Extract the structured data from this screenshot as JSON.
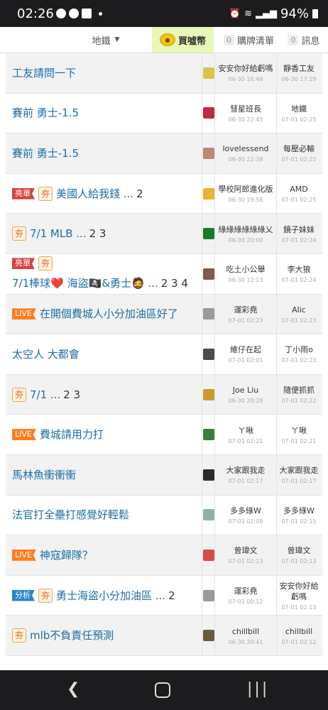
{
  "status": {
    "time": "02:26",
    "battery": "94%"
  },
  "tabs": {
    "board": "地鐵",
    "buy": "買噓幣",
    "list_count": "0",
    "list_label": "購牌清單",
    "msg_count": "0",
    "msg_label": "訊息"
  },
  "threads": [
    {
      "tags": [],
      "title": "工友請問一下",
      "pages": "",
      "author": "安安你好給虧嗎",
      "post_date": "06-30 16:46",
      "last_author": "靜香工友",
      "last_date": "06-30 17:29",
      "thumb_color": "#d9c54a"
    },
    {
      "tags": [],
      "title": "賽前 勇士-1.5",
      "pages": "",
      "author": "彗星班長",
      "post_date": "06-30 22:45",
      "last_author": "地鐵",
      "last_date": "07-01 02:25",
      "thumb_color": "#c3264a"
    },
    {
      "tags": [],
      "title": "賽前 勇士-1.5",
      "pages": "",
      "author": "lovelessend",
      "post_date": "06-30 22:38",
      "last_author": "每壓必輸",
      "last_date": "07-01 02:25",
      "thumb_color": "#b98a78"
    },
    {
      "tags": [
        "亮單",
        "夯"
      ],
      "title": "美國人給我錢 ...",
      "pages": "2",
      "author": "學校阿郎進化版",
      "post_date": "06-30 19:58",
      "last_author": "AMD",
      "last_date": "07-01 02:25",
      "thumb_color": "#e5b533"
    },
    {
      "tags": [
        "夯"
      ],
      "title": "7/1 MLB ...",
      "pages": "2 3",
      "author": "綠綠綠綠綠綠乂",
      "post_date": "06-30 20:00",
      "last_author": "鏡子妹妹",
      "last_date": "07-01 02:24",
      "thumb_color": "#1d7a2a"
    },
    {
      "tags": [
        "亮單",
        "夯"
      ],
      "title": "7/1棒球❤️ 海盜🏴‍☠️&勇士🧔 ...",
      "pages": "2 3 4",
      "author": "吃土小公舉",
      "post_date": "06-30 12:13",
      "last_author": "李大狼",
      "last_date": "07-01 02:24",
      "thumb_color": "#7d5a4a"
    },
    {
      "tags": [
        "LIVE"
      ],
      "title": "在開個費城人小分加油區好了",
      "pages": "",
      "author": "運彩堯",
      "post_date": "07-01 02:23",
      "last_author": "Alic",
      "last_date": "07-01 02:23",
      "thumb_color": "#9a9a9a"
    },
    {
      "tags": [],
      "title": "太空人 大都會",
      "pages": "",
      "author": "維仔在起",
      "post_date": "07-01 02:01",
      "last_author": "丁小雨o",
      "last_date": "07-01 02:23",
      "thumb_color": "#4a4a4a"
    },
    {
      "tags": [
        "夯"
      ],
      "title": "7/1 ...",
      "pages": "2 3",
      "author": "Joe Liu",
      "post_date": "06-30 20:28",
      "last_author": "隨便抓抓",
      "last_date": "07-01 02:22",
      "thumb_color": "#c99a2e"
    },
    {
      "tags": [
        "LIVE"
      ],
      "title": "費城請用力打",
      "pages": "",
      "author": "ㄚ啾",
      "post_date": "07-01 02:21",
      "last_author": "ㄚ啾",
      "last_date": "07-01 02:21",
      "thumb_color": "#3f7b3f"
    },
    {
      "tags": [],
      "title": "馬林魚衝衝衝",
      "pages": "",
      "author": "大家跟我走",
      "post_date": "07-01 02:17",
      "last_author": "大家跟我走",
      "last_date": "07-01 02:17",
      "thumb_color": "#2b2b2b"
    },
    {
      "tags": [],
      "title": "法官打全壘打感覺好輕鬆",
      "pages": "",
      "author": "多多綠W",
      "post_date": "07-01 02:09",
      "last_author": "多多綠W",
      "last_date": "07-01 02:15",
      "thumb_color": "#8fb3a0"
    },
    {
      "tags": [
        "LIVE"
      ],
      "title": "神寇歸隊？",
      "pages": "",
      "author": "曾瑋文",
      "post_date": "07-01 02:13",
      "last_author": "曾瑋文",
      "last_date": "07-01 02:13",
      "thumb_color": "#d94a4a"
    },
    {
      "tags": [
        "分析",
        "夯"
      ],
      "title": "勇士海盜小分加油區 ...",
      "pages": "2",
      "author": "運彩堯",
      "post_date": "07-01 00:12",
      "last_author": "安安你好給虧嗎",
      "last_date": "07-01 02:13",
      "thumb_color": "#9a9a9a"
    },
    {
      "tags": [
        "夯"
      ],
      "title": "mlb不負責任預測",
      "pages": "",
      "author": "chillbill",
      "post_date": "06-30 20:41",
      "last_author": "chillbill",
      "last_date": "07-01 02:12",
      "thumb_color": "#6b5a3a"
    }
  ]
}
